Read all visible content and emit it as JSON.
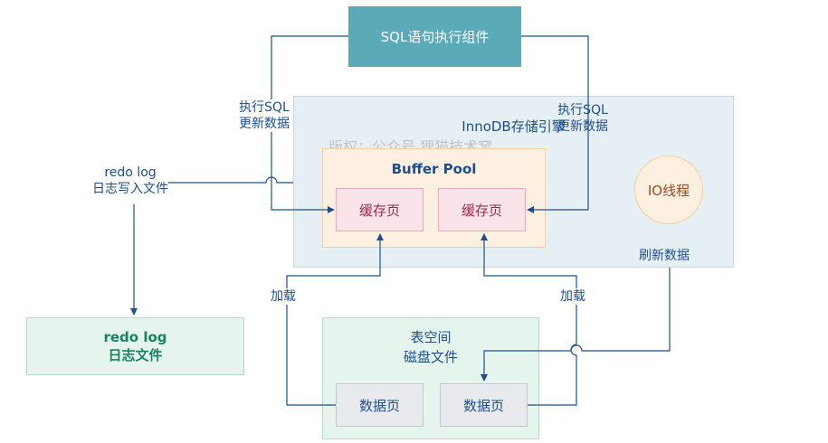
{
  "sql_component": "SQL语句执行组件",
  "innodb": {
    "title": "InnoDB存储引擎"
  },
  "watermark": "版权：公众号 狸猫技术窝",
  "buffer_pool": {
    "title": "Buffer Pool",
    "pages": [
      "缓存页",
      "缓存页"
    ]
  },
  "io_thread": "IO线程",
  "redo_log_file": {
    "line1": "redo log",
    "line2": "日志文件"
  },
  "tablespace": {
    "line1": "表空间",
    "line2": "磁盘文件",
    "pages": [
      "数据页",
      "数据页"
    ]
  },
  "labels": {
    "exec_left": {
      "line1": "执行SQL",
      "line2": "更新数据"
    },
    "exec_right": {
      "line1": "执行SQL",
      "line2": "更新数据"
    },
    "redo_write": {
      "line1": "redo log",
      "line2": "日志写入文件"
    },
    "flush": "刷新数据",
    "load_left": "加载",
    "load_right": "加载"
  },
  "colors": {
    "line": "#1e4f8c",
    "sql_box": "#5aaab8",
    "innodb_bg": "#e6eff4",
    "buffer_pool_bg": "#fdf0e1",
    "cache_page_bg": "#fbe3ea",
    "disk_bg": "#e5f5ee",
    "redo_text": "#17845f"
  }
}
